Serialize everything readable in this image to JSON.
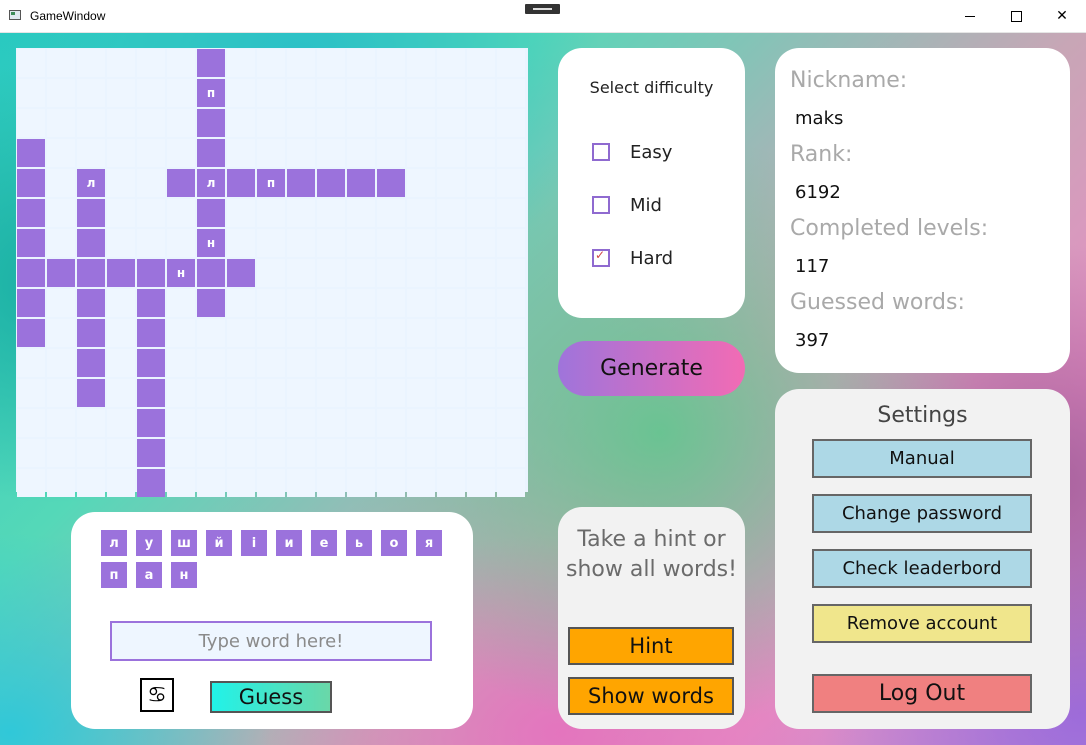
{
  "window": {
    "title": "GameWindow",
    "controls": {
      "minimize": "",
      "maximize": "",
      "close": "✕"
    }
  },
  "crossword": {
    "grid_cols": 17,
    "grid_rows": 15,
    "cells": [
      {
        "r": 0,
        "c": 6,
        "t": ""
      },
      {
        "r": 1,
        "c": 6,
        "t": "п"
      },
      {
        "r": 2,
        "c": 6,
        "t": ""
      },
      {
        "r": 3,
        "c": 0,
        "t": ""
      },
      {
        "r": 3,
        "c": 6,
        "t": ""
      },
      {
        "r": 4,
        "c": 0,
        "t": ""
      },
      {
        "r": 4,
        "c": 2,
        "t": "л"
      },
      {
        "r": 4,
        "c": 5,
        "t": ""
      },
      {
        "r": 4,
        "c": 6,
        "t": "л"
      },
      {
        "r": 4,
        "c": 7,
        "t": ""
      },
      {
        "r": 4,
        "c": 8,
        "t": "п"
      },
      {
        "r": 4,
        "c": 9,
        "t": ""
      },
      {
        "r": 4,
        "c": 10,
        "t": ""
      },
      {
        "r": 4,
        "c": 11,
        "t": ""
      },
      {
        "r": 4,
        "c": 12,
        "t": ""
      },
      {
        "r": 5,
        "c": 0,
        "t": ""
      },
      {
        "r": 5,
        "c": 2,
        "t": ""
      },
      {
        "r": 5,
        "c": 6,
        "t": ""
      },
      {
        "r": 6,
        "c": 0,
        "t": ""
      },
      {
        "r": 6,
        "c": 2,
        "t": ""
      },
      {
        "r": 6,
        "c": 6,
        "t": "н"
      },
      {
        "r": 7,
        "c": 0,
        "t": ""
      },
      {
        "r": 7,
        "c": 1,
        "t": ""
      },
      {
        "r": 7,
        "c": 2,
        "t": ""
      },
      {
        "r": 7,
        "c": 3,
        "t": ""
      },
      {
        "r": 7,
        "c": 4,
        "t": ""
      },
      {
        "r": 7,
        "c": 5,
        "t": "н"
      },
      {
        "r": 7,
        "c": 6,
        "t": ""
      },
      {
        "r": 7,
        "c": 7,
        "t": ""
      },
      {
        "r": 8,
        "c": 0,
        "t": ""
      },
      {
        "r": 8,
        "c": 2,
        "t": ""
      },
      {
        "r": 8,
        "c": 4,
        "t": ""
      },
      {
        "r": 8,
        "c": 6,
        "t": ""
      },
      {
        "r": 9,
        "c": 0,
        "t": ""
      },
      {
        "r": 9,
        "c": 2,
        "t": ""
      },
      {
        "r": 9,
        "c": 4,
        "t": ""
      },
      {
        "r": 10,
        "c": 2,
        "t": ""
      },
      {
        "r": 10,
        "c": 4,
        "t": ""
      },
      {
        "r": 11,
        "c": 2,
        "t": ""
      },
      {
        "r": 11,
        "c": 4,
        "t": ""
      },
      {
        "r": 12,
        "c": 4,
        "t": ""
      },
      {
        "r": 13,
        "c": 4,
        "t": ""
      },
      {
        "r": 14,
        "c": 4,
        "t": ""
      }
    ]
  },
  "difficulty": {
    "title": "Select difficulty",
    "options": [
      {
        "label": "Easy",
        "checked": false
      },
      {
        "label": "Mid",
        "checked": false
      },
      {
        "label": "Hard",
        "checked": true
      }
    ]
  },
  "generate_label": "Generate",
  "profile": {
    "nickname_label": "Nickname:",
    "nickname": "maks",
    "rank_label": "Rank:",
    "rank": "6192",
    "levels_label": "Completed levels:",
    "levels": "117",
    "guessed_label": "Guessed words:",
    "guessed": "397"
  },
  "letters": {
    "row1": [
      "л",
      "у",
      "ш",
      "й",
      "і",
      "и",
      "е",
      "ь",
      "о",
      "я"
    ],
    "row2": [
      "п",
      "а",
      "н"
    ],
    "input_placeholder": "Type word here!",
    "input_value": "",
    "shuffle_icon": "♋",
    "guess_label": "Guess"
  },
  "hint": {
    "text": "Take a hint or show all words!",
    "hint_label": "Hint",
    "show_words_label": "Show words"
  },
  "settings": {
    "title": "Settings",
    "manual_label": "Manual",
    "change_password_label": "Change password",
    "leaderboard_label": "Check leaderbord",
    "remove_account_label": "Remove account",
    "logout_label": "Log Out"
  },
  "colors": {
    "cell_active": "#9b72dc",
    "cell_empty": "#eef6ff",
    "generate_gradient": [
      "#9f74db",
      "#f26bb4"
    ],
    "guess_gradient": [
      "#21f2e8",
      "#6ad7a8"
    ],
    "hint_buttons": "#ffa500",
    "settings_blue": "#add8e6",
    "settings_yellow": "#f0e68c",
    "settings_red": "#f08080"
  }
}
